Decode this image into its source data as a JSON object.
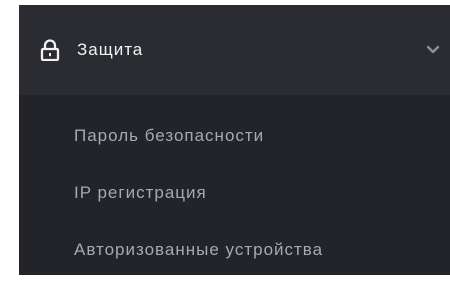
{
  "security_menu": {
    "title": "Защита",
    "icons": {
      "section": "lock-icon",
      "toggle": "chevron-down-icon"
    },
    "items": [
      {
        "label": "Пароль безопасности"
      },
      {
        "label": "IP регистрация"
      },
      {
        "label": "Авторизованные устройства"
      }
    ]
  },
  "colors": {
    "header_bg": "#2a2c32",
    "submenu_bg": "#222429",
    "header_text": "#f2f2f2",
    "item_text": "#a8a9ac",
    "chevron": "#8d8f94"
  }
}
